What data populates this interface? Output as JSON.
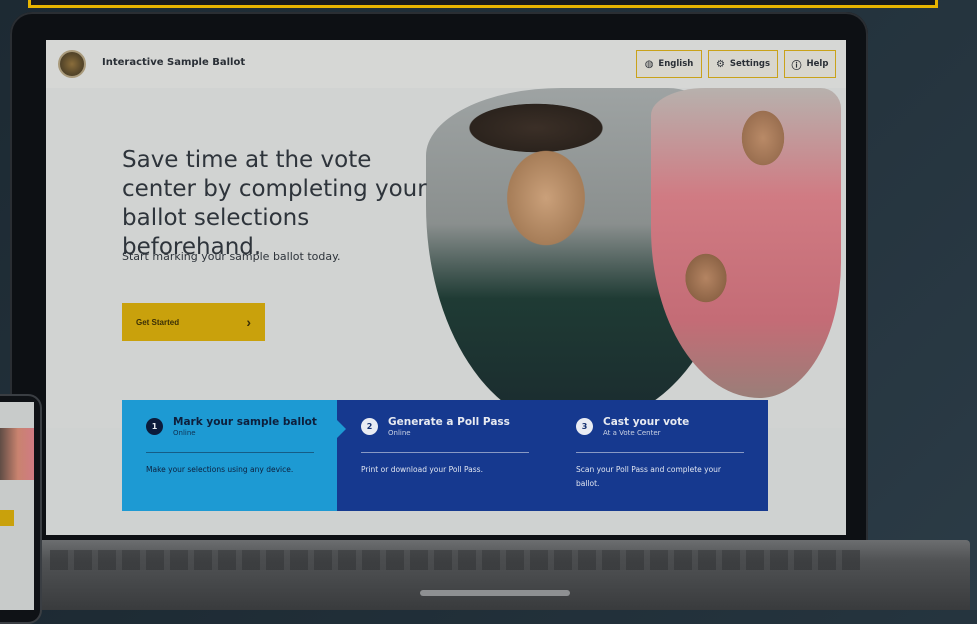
{
  "app": {
    "title": "Interactive Sample Ballot"
  },
  "header": {
    "language_label": "English",
    "settings_label": "Settings",
    "help_label": "Help"
  },
  "hero": {
    "headline": "Save time at the vote center by completing your ballot selections beforehand.",
    "subline": "Start marking your sample ballot today.",
    "cta_label": "Get Started"
  },
  "steps": [
    {
      "number": "1",
      "title": "Mark your sample ballot",
      "sub": "Online",
      "desc": "Make your selections using any device."
    },
    {
      "number": "2",
      "title": "Generate a Poll Pass",
      "sub": "Online",
      "desc": "Print or download your Poll Pass."
    },
    {
      "number": "3",
      "title": "Cast your vote",
      "sub": "At a Vote Center",
      "desc": "Scan your Poll Pass and complete your ballot."
    }
  ],
  "icons": {
    "globe": "globe-icon",
    "settings": "gear-icon",
    "help": "help-icon",
    "chevron": "chevron-right-icon"
  },
  "colors": {
    "accent_yellow": "#c9a10c",
    "step_blue": "#16398f",
    "step_active": "#1d9ad3"
  }
}
